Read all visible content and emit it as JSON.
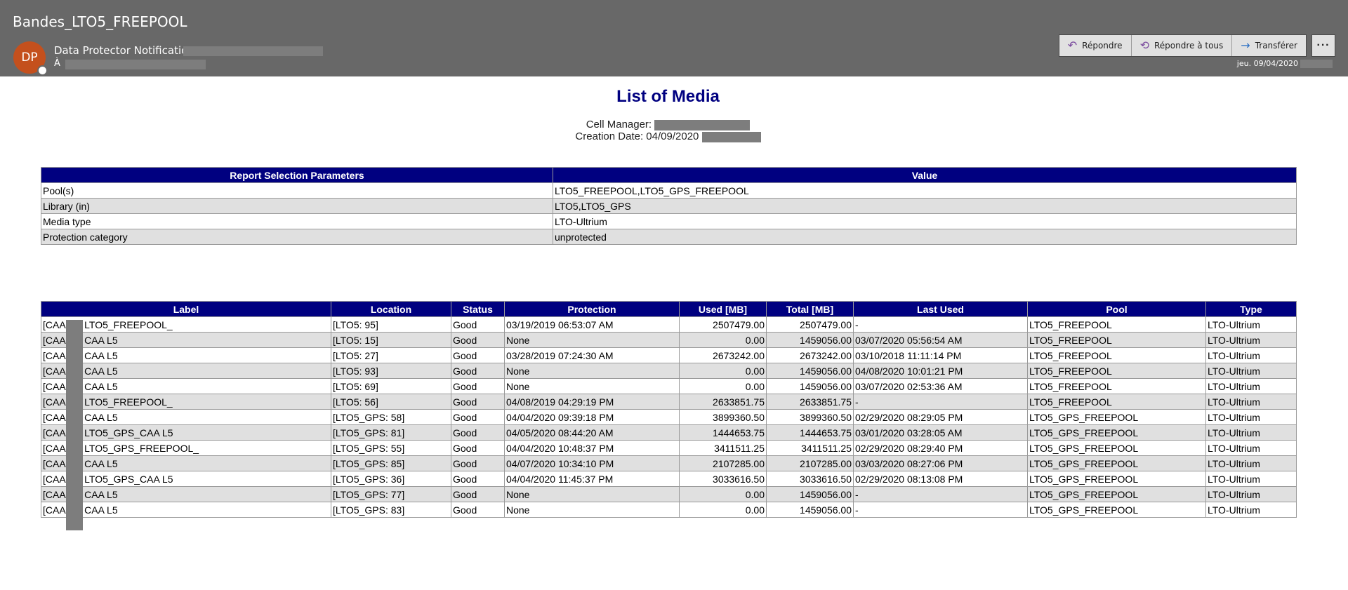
{
  "email": {
    "subject": "Bandes_LTO5_FREEPOOL",
    "avatar_initials": "DP",
    "sender": "Data Protector Notification",
    "to_label": "À",
    "date": "jeu. 09/04/2020",
    "actions": [
      {
        "label": "Répondre",
        "icon": "reply-icon"
      },
      {
        "label": "Répondre à tous",
        "icon": "reply-all-icon"
      },
      {
        "label": "Transférer",
        "icon": "forward-icon"
      }
    ],
    "more_label": "···",
    "avatar_color": "#c4501d",
    "header_bg": "#686868"
  },
  "report": {
    "title": "List of Media",
    "cell_manager_label": "Cell Manager:",
    "creation_date_label": "Creation Date: 04/09/2020",
    "header_color": "#000080"
  },
  "params": {
    "headers": [
      "Report Selection Parameters",
      "Value"
    ],
    "rows": [
      [
        "Pool(s)",
        "LTO5_FREEPOOL,LTO5_GPS_FREEPOOL"
      ],
      [
        "Library (in)",
        "LTO5,LTO5_GPS"
      ],
      [
        "Media type",
        "LTO-Ultrium"
      ],
      [
        "Protection category",
        "unprotected"
      ]
    ]
  },
  "media": {
    "headers": [
      "Label",
      "Location",
      "Status",
      "Protection",
      "Used [MB]",
      "Total [MB]",
      "Last Used",
      "Pool",
      "Type"
    ],
    "rows": [
      [
        "[CAA     L5] LTO5_FREEPOOL_",
        "[LTO5: 95]",
        "Good",
        "03/19/2019 06:53:07 AM",
        "2507479.00",
        "2507479.00",
        "-",
        "LTO5_FREEPOOL",
        "LTO-Ultrium"
      ],
      [
        "[CAA     L5] CAA     L5",
        "[LTO5: 15]",
        "Good",
        "None",
        "0.00",
        "1459056.00",
        "03/07/2020 05:56:54 AM",
        "LTO5_FREEPOOL",
        "LTO-Ultrium"
      ],
      [
        "[CAA     L5] CAA     L5",
        "[LTO5: 27]",
        "Good",
        "03/28/2019 07:24:30 AM",
        "2673242.00",
        "2673242.00",
        "03/10/2018 11:11:14 PM",
        "LTO5_FREEPOOL",
        "LTO-Ultrium"
      ],
      [
        "[CAA     L5] CAA     L5",
        "[LTO5: 93]",
        "Good",
        "None",
        "0.00",
        "1459056.00",
        "04/08/2020 10:01:21 PM",
        "LTO5_FREEPOOL",
        "LTO-Ultrium"
      ],
      [
        "[CAA     L5] CAA     L5",
        "[LTO5: 69]",
        "Good",
        "None",
        "0.00",
        "1459056.00",
        "03/07/2020 02:53:36 AM",
        "LTO5_FREEPOOL",
        "LTO-Ultrium"
      ],
      [
        "[CAA     L5] LTO5_FREEPOOL_",
        "[LTO5: 56]",
        "Good",
        "04/08/2019 04:29:19 PM",
        "2633851.75",
        "2633851.75",
        "-",
        "LTO5_FREEPOOL",
        "LTO-Ultrium"
      ],
      [
        "[CAA     L5] CAA     L5",
        "[LTO5_GPS: 58]",
        "Good",
        "04/04/2020 09:39:18 PM",
        "3899360.50",
        "3899360.50",
        "02/29/2020 08:29:05 PM",
        "LTO5_GPS_FREEPOOL",
        "LTO-Ultrium"
      ],
      [
        "[CAA     L5] LTO5_GPS_CAA     L5",
        "[LTO5_GPS: 81]",
        "Good",
        "04/05/2020 08:44:20 AM",
        "1444653.75",
        "1444653.75",
        "03/01/2020 03:28:05 AM",
        "LTO5_GPS_FREEPOOL",
        "LTO-Ultrium"
      ],
      [
        "[CAA     L5] LTO5_GPS_FREEPOOL_",
        "[LTO5_GPS: 55]",
        "Good",
        "04/04/2020 10:48:37 PM",
        "3411511.25",
        "3411511.25",
        "02/29/2020 08:29:40 PM",
        "LTO5_GPS_FREEPOOL",
        "LTO-Ultrium"
      ],
      [
        "[CAA     L5] CAA     L5",
        "[LTO5_GPS: 85]",
        "Good",
        "04/07/2020 10:34:10 PM",
        "2107285.00",
        "2107285.00",
        "03/03/2020 08:27:06 PM",
        "LTO5_GPS_FREEPOOL",
        "LTO-Ultrium"
      ],
      [
        "[CAA     L5] LTO5_GPS_CAA     L5",
        "[LTO5_GPS: 36]",
        "Good",
        "04/04/2020 11:45:37 PM",
        "3033616.50",
        "3033616.50",
        "02/29/2020 08:13:08 PM",
        "LTO5_GPS_FREEPOOL",
        "LTO-Ultrium"
      ],
      [
        "[CAA     L5] CAA     L5",
        "[LTO5_GPS: 77]",
        "Good",
        "None",
        "0.00",
        "1459056.00",
        "-",
        "LTO5_GPS_FREEPOOL",
        "LTO-Ultrium"
      ],
      [
        "[CAA     L5] CAA     L5",
        "[LTO5_GPS: 83]",
        "Good",
        "None",
        "0.00",
        "1459056.00",
        "-",
        "LTO5_GPS_FREEPOOL",
        "LTO-Ultrium"
      ]
    ]
  }
}
